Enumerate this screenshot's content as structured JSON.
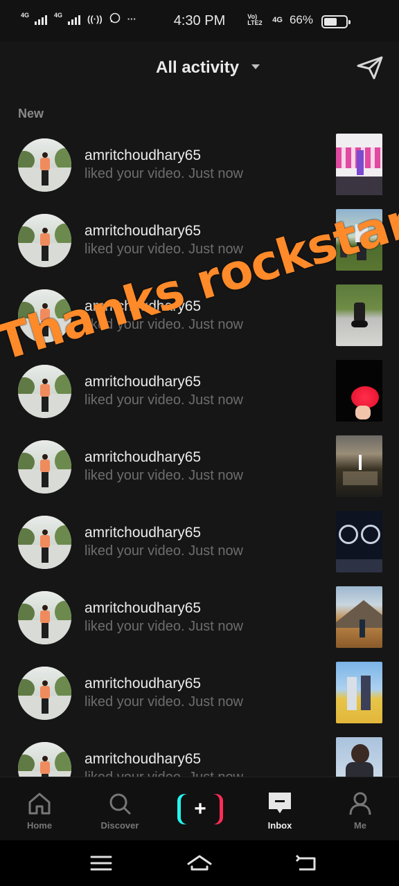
{
  "status_bar": {
    "network_1": "4G",
    "network_2": "4G",
    "more": "···",
    "time": "4:30 PM",
    "volte": "Vo) LTE2",
    "network_3": "4G",
    "battery": "66%",
    "battery_level": 0.66
  },
  "header": {
    "title": "All activity"
  },
  "section": {
    "new_label": "New"
  },
  "notifications": [
    {
      "user": "amritchoudhary65",
      "text": "liked your video. Just now",
      "thumb": "stage"
    },
    {
      "user": "amritchoudhary65",
      "text": "liked your video. Just now",
      "thumb": "field"
    },
    {
      "user": "amritchoudhary65",
      "text": "liked your video. Just now",
      "thumb": "road"
    },
    {
      "user": "amritchoudhary65",
      "text": "liked your video. Just now",
      "thumb": "rose"
    },
    {
      "user": "amritchoudhary65",
      "text": "liked your video. Just now",
      "thumb": "lake"
    },
    {
      "user": "amritchoudhary65",
      "text": "liked your video. Just now",
      "thumb": "bike"
    },
    {
      "user": "amritchoudhary65",
      "text": "liked your video. Just now",
      "thumb": "mountain"
    },
    {
      "user": "amritchoudhary65",
      "text": "liked your video. Just now",
      "thumb": "friends"
    },
    {
      "user": "amritchoudhary65",
      "text": "liked your video. Just now",
      "thumb": "portrait"
    }
  ],
  "overlay": {
    "text": "Thanks rockstar",
    "color": "#ff8a2a"
  },
  "tabs": {
    "home": "Home",
    "discover": "Discover",
    "create": "+",
    "inbox": "Inbox",
    "me": "Me",
    "active": "inbox"
  },
  "colors": {
    "background": "#161616",
    "create_left": "#25f4ee",
    "create_right": "#fe2c55"
  }
}
